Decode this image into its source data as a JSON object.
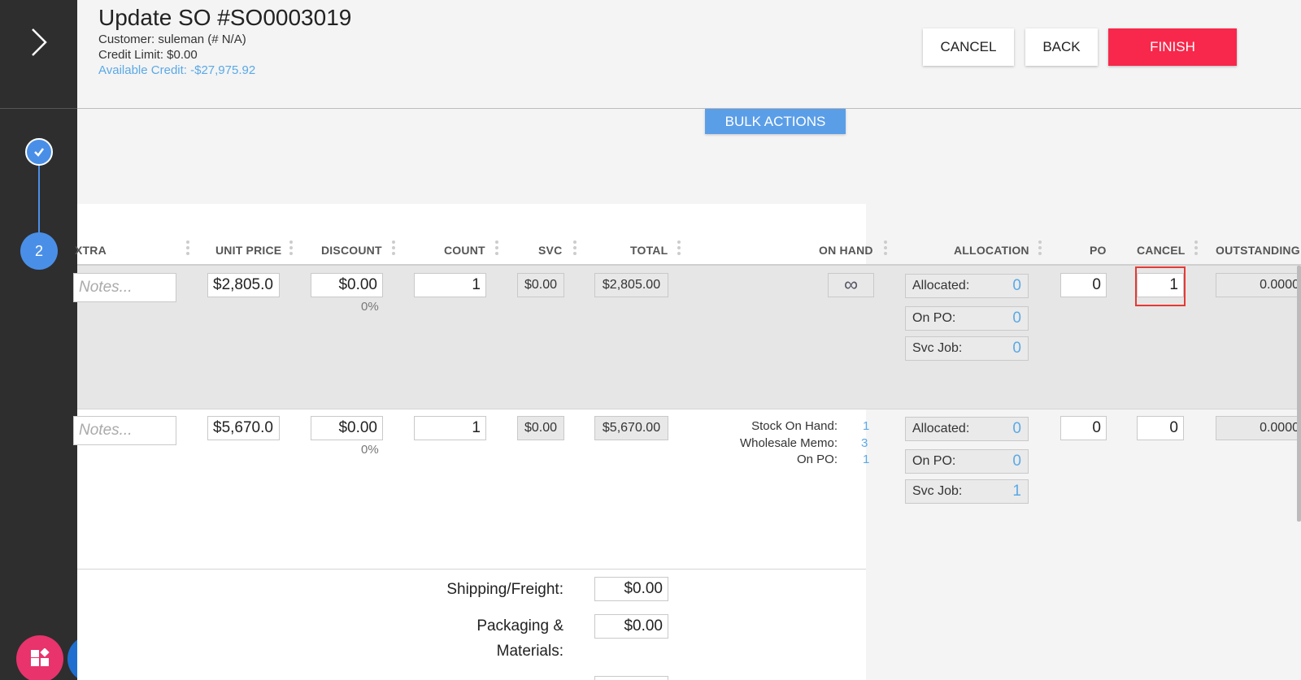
{
  "rail": {
    "step2_label": "2"
  },
  "header": {
    "title": "Update SO #SO0003019",
    "customer": "Customer: suleman (# N/A)",
    "credit_limit": "Credit Limit: $0.00",
    "available_credit": "Available Credit: -$27,975.92",
    "cancel_label": "CANCEL",
    "back_label": "BACK",
    "finish_label": "FINISH"
  },
  "bulk_actions_label": "BULK ACTIONS",
  "columns": {
    "extra": "XTRA",
    "unit_price": "UNIT PRICE",
    "discount": "DISCOUNT",
    "count": "COUNT",
    "svc": "SVC",
    "total": "TOTAL",
    "on_hand": "ON HAND",
    "allocation": "ALLOCATION",
    "po": "PO",
    "cancel": "CANCEL",
    "outstanding": "OUTSTANDING"
  },
  "rows": [
    {
      "notes_placeholder": "Notes...",
      "unit_price": "$2,805.0",
      "discount": "$0.00",
      "discount_pct": "0%",
      "count": "1",
      "svc": "$0.00",
      "total": "$2,805.00",
      "on_hand": "∞",
      "allocated_label": "Allocated:",
      "allocated": "0",
      "on_po_label": "On PO:",
      "on_po": "0",
      "svc_job_label": "Svc Job:",
      "svc_job": "0",
      "po": "0",
      "cancel": "1",
      "outstanding": "0.0000"
    },
    {
      "notes_placeholder": "Notes...",
      "unit_price": "$5,670.0",
      "discount": "$0.00",
      "discount_pct": "0%",
      "count": "1",
      "svc": "$0.00",
      "total": "$5,670.00",
      "stock_on_hand_label": "Stock On Hand:",
      "stock_on_hand": "1",
      "wholesale_memo_label": "Wholesale Memo:",
      "wholesale_memo": "3",
      "on_po_stock_label": "On PO:",
      "on_po_stock": "1",
      "allocated_label": "Allocated:",
      "allocated": "0",
      "on_po_label": "On PO:",
      "on_po": "0",
      "svc_job_label": "Svc Job:",
      "svc_job": "1",
      "po": "0",
      "cancel": "0",
      "outstanding": "0.0000"
    }
  ],
  "footer": {
    "shipping_label": "Shipping/Freight:",
    "shipping_value": "$0.00",
    "packaging_label_1": "Packaging &",
    "packaging_label_2": "Materials:",
    "packaging_value": "$0.00"
  }
}
